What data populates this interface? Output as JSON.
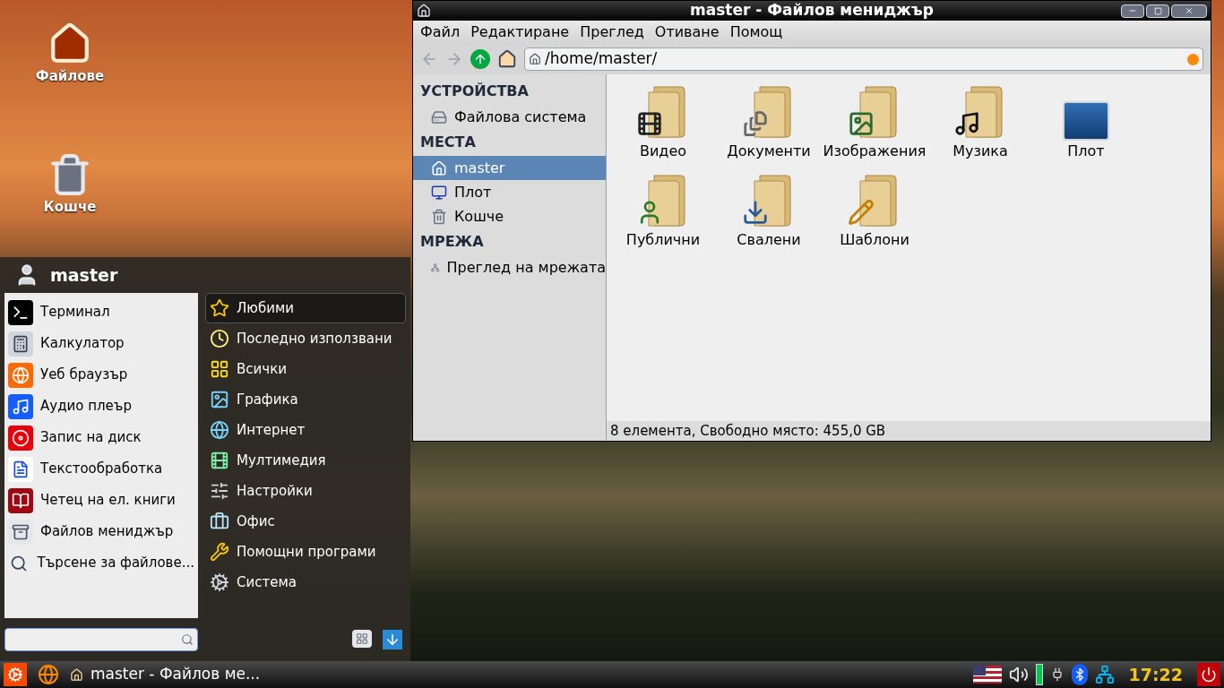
{
  "desktop_icons": [
    {
      "label": "Файлове",
      "kind": "home"
    },
    {
      "label": "Кошче",
      "kind": "trash"
    }
  ],
  "menu": {
    "user": "master",
    "favorites": [
      {
        "label": "Терминал",
        "kind": "terminal"
      },
      {
        "label": "Калкулатор",
        "kind": "calculator"
      },
      {
        "label": "Уеб браузър",
        "kind": "browser"
      },
      {
        "label": "Аудио плеър",
        "kind": "audio"
      },
      {
        "label": "Запис на диск",
        "kind": "disc"
      },
      {
        "label": "Текстообработка",
        "kind": "writer"
      },
      {
        "label": "Четец на ел. книги",
        "kind": "book"
      },
      {
        "label": "Файлов мениджър",
        "kind": "files"
      },
      {
        "label": "Търсене за файлове...",
        "kind": "search"
      }
    ],
    "categories": [
      {
        "label": "Любими",
        "kind": "star",
        "selected": true
      },
      {
        "label": "Последно използвани",
        "kind": "clock",
        "selected": false
      },
      {
        "label": "Всички",
        "kind": "all",
        "selected": false
      },
      {
        "label": "Графика",
        "kind": "graphics",
        "selected": false
      },
      {
        "label": "Интернет",
        "kind": "internet",
        "selected": false
      },
      {
        "label": "Мултимедия",
        "kind": "multimedia",
        "selected": false
      },
      {
        "label": "Настройки",
        "kind": "settings",
        "selected": false
      },
      {
        "label": "Офис",
        "kind": "office",
        "selected": false
      },
      {
        "label": "Помощни програми",
        "kind": "tools",
        "selected": false
      },
      {
        "label": "Система",
        "kind": "system",
        "selected": false
      }
    ]
  },
  "file_manager": {
    "title": "master - Файлов мениджър",
    "menu_bar": [
      "Файл",
      "Редактиране",
      "Преглед",
      "Отиване",
      "Помощ"
    ],
    "location": "/home/master/",
    "sidebar": [
      {
        "heading": "УСТРОЙСТВА",
        "items": [
          {
            "label": "Файлова система",
            "kind": "drive",
            "selected": false
          }
        ]
      },
      {
        "heading": "МЕСТА",
        "items": [
          {
            "label": "master",
            "kind": "home",
            "selected": true
          },
          {
            "label": "Плот",
            "kind": "desktop",
            "selected": false
          },
          {
            "label": "Кошче",
            "kind": "trash",
            "selected": false
          }
        ]
      },
      {
        "heading": "МРЕЖА",
        "items": [
          {
            "label": "Преглед на мрежата",
            "kind": "network",
            "selected": false
          }
        ]
      }
    ],
    "items": [
      {
        "label": "Видео",
        "kind": "video"
      },
      {
        "label": "Документи",
        "kind": "documents"
      },
      {
        "label": "Изображения",
        "kind": "pictures"
      },
      {
        "label": "Музика",
        "kind": "music"
      },
      {
        "label": "Плот",
        "kind": "desktop"
      },
      {
        "label": "Публични",
        "kind": "public"
      },
      {
        "label": "Свалени",
        "kind": "downloads"
      },
      {
        "label": "Шаблони",
        "kind": "templates"
      }
    ],
    "status": "8 елемента, Свободно място: 455,0 GB"
  },
  "taskbar": {
    "task": "master - Файлов ме...",
    "clock": "17:22"
  }
}
